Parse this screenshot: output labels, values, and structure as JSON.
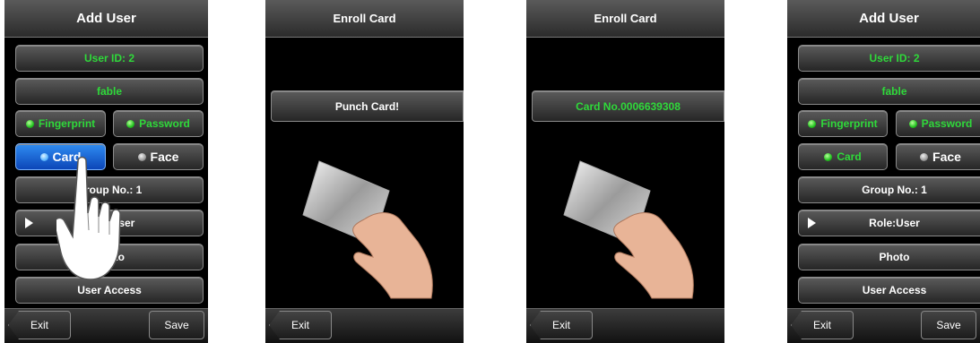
{
  "screen1": {
    "title": "Add User",
    "user_id": "User ID: 2",
    "name": "fable",
    "fingerprint": "Fingerprint",
    "password": "Password",
    "card": "Card",
    "face": "Face",
    "group": "Group No.: 1",
    "role": "Role:User",
    "photo": "Photo",
    "user_access": "User Access",
    "exit": "Exit",
    "save": "Save"
  },
  "screen2": {
    "title": "Enroll Card",
    "message": "Punch Card!",
    "exit": "Exit"
  },
  "screen3": {
    "title": "Enroll Card",
    "card_number": "Card No.0006639308",
    "exit": "Exit"
  },
  "screen4": {
    "title": "Add User",
    "user_id": "User ID: 2",
    "name": "fable",
    "fingerprint": "Fingerprint",
    "password": "Password",
    "card": "Card",
    "face": "Face",
    "group": "Group No.: 1",
    "role": "Role:User",
    "photo": "Photo",
    "user_access": "User Access",
    "exit": "Exit",
    "save": "Save"
  },
  "colors": {
    "active_green": "#2fd93a",
    "selected_blue": "#2f8cf1",
    "background": "#000000"
  },
  "icons": [
    "fingerprint-status-dot",
    "password-status-dot",
    "card-status-dot",
    "face-status-dot",
    "role-arrow-icon",
    "tap-hand-icon",
    "card-hand-illustration"
  ]
}
